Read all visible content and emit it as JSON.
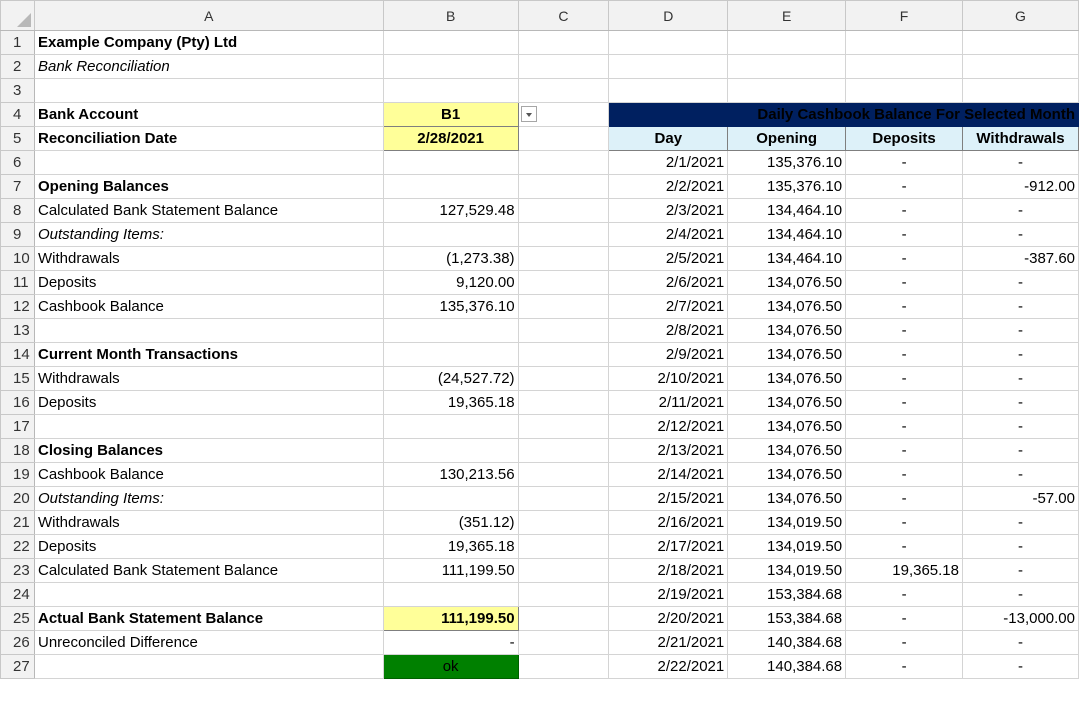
{
  "columns": [
    "A",
    "B",
    "C",
    "D",
    "E",
    "F",
    "G"
  ],
  "rownums": [
    "1",
    "2",
    "3",
    "4",
    "5",
    "6",
    "7",
    "8",
    "9",
    "10",
    "11",
    "12",
    "13",
    "14",
    "15",
    "16",
    "17",
    "18",
    "19",
    "20",
    "21",
    "22",
    "23",
    "24",
    "25",
    "26",
    "27"
  ],
  "company": "Example Company (Pty) Ltd",
  "subtitle": "Bank Reconciliation",
  "bank_account": {
    "label": "Bank Account",
    "value": "B1"
  },
  "recon_date": {
    "label": "Reconciliation Date",
    "value": "2/28/2021"
  },
  "labels": {
    "r7": "Opening Balances",
    "r8": "Calculated Bank Statement Balance",
    "r9": "Outstanding Items:",
    "r10": "Withdrawals",
    "r11": "Deposits",
    "r12": "Cashbook Balance",
    "r14": "Current Month Transactions",
    "r15": "Withdrawals",
    "r16": "Deposits",
    "r18": "Closing Balances",
    "r19": "Cashbook Balance",
    "r20": "Outstanding Items:",
    "r21": "Withdrawals",
    "r22": "Deposits",
    "r23": "Calculated Bank Statement Balance",
    "r25": "Actual Bank Statement Balance",
    "r26": "Unreconciled Difference"
  },
  "values": {
    "r8": "127,529.48",
    "r10": "(1,273.38)",
    "r11": "9,120.00",
    "r12": "135,376.10",
    "r15": "(24,527.72)",
    "r16": "19,365.18",
    "r19": "130,213.56",
    "r21": "(351.12)",
    "r22": "19,365.18",
    "r23": "111,199.50",
    "r25": "111,199.50",
    "r26": "-",
    "r27": "ok"
  },
  "cashbook": {
    "title": "Daily Cashbook Balance For Selected Month",
    "headers": [
      "Day",
      "Opening",
      "Deposits",
      "Withdrawals"
    ],
    "rows": [
      [
        "2/1/2021",
        "135,376.10",
        "-",
        "-"
      ],
      [
        "2/2/2021",
        "135,376.10",
        "-",
        "-912.00"
      ],
      [
        "2/3/2021",
        "134,464.10",
        "-",
        "-"
      ],
      [
        "2/4/2021",
        "134,464.10",
        "-",
        "-"
      ],
      [
        "2/5/2021",
        "134,464.10",
        "-",
        "-387.60"
      ],
      [
        "2/6/2021",
        "134,076.50",
        "-",
        "-"
      ],
      [
        "2/7/2021",
        "134,076.50",
        "-",
        "-"
      ],
      [
        "2/8/2021",
        "134,076.50",
        "-",
        "-"
      ],
      [
        "2/9/2021",
        "134,076.50",
        "-",
        "-"
      ],
      [
        "2/10/2021",
        "134,076.50",
        "-",
        "-"
      ],
      [
        "2/11/2021",
        "134,076.50",
        "-",
        "-"
      ],
      [
        "2/12/2021",
        "134,076.50",
        "-",
        "-"
      ],
      [
        "2/13/2021",
        "134,076.50",
        "-",
        "-"
      ],
      [
        "2/14/2021",
        "134,076.50",
        "-",
        "-"
      ],
      [
        "2/15/2021",
        "134,076.50",
        "-",
        "-57.00"
      ],
      [
        "2/16/2021",
        "134,019.50",
        "-",
        "-"
      ],
      [
        "2/17/2021",
        "134,019.50",
        "-",
        "-"
      ],
      [
        "2/18/2021",
        "134,019.50",
        "19,365.18",
        "-"
      ],
      [
        "2/19/2021",
        "153,384.68",
        "-",
        "-"
      ],
      [
        "2/20/2021",
        "153,384.68",
        "-",
        "-13,000.00"
      ],
      [
        "2/21/2021",
        "140,384.68",
        "-",
        "-"
      ],
      [
        "2/22/2021",
        "140,384.68",
        "-",
        "-"
      ]
    ]
  },
  "colors": {
    "input_yellow": "#ffff99",
    "header_navy": "#002060",
    "header_cyan": "#ddf1f9",
    "status_green": "#008000"
  },
  "icons": {
    "dropdown": "chevron-down-icon",
    "select_all": "select-all-triangle-icon"
  }
}
